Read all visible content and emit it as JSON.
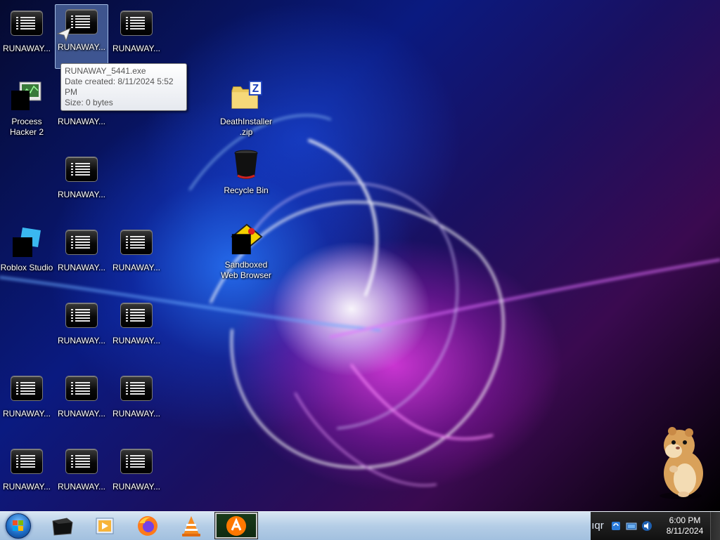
{
  "desktop_icons": [
    {
      "id": "r1",
      "label": "RUNAWAY...",
      "kind": "terminal"
    },
    {
      "id": "r2",
      "label": "RUNAWAY...",
      "kind": "terminal"
    },
    {
      "id": "r3",
      "label": "RUNAWAY...",
      "kind": "terminal"
    },
    {
      "id": "ph",
      "label": "Process Hacker 2",
      "kind": "process-hacker"
    },
    {
      "id": "r4",
      "label": "RUNAWAY...",
      "kind": "terminal"
    },
    {
      "id": "dz",
      "label": "DeathInstaller.zip",
      "kind": "zip"
    },
    {
      "id": "r5",
      "label": "RUNAWAY...",
      "kind": "terminal"
    },
    {
      "id": "rb",
      "label": "Recycle Bin",
      "kind": "recycle-bin"
    },
    {
      "id": "rs",
      "label": "Roblox Studio",
      "kind": "roblox-studio"
    },
    {
      "id": "r6",
      "label": "RUNAWAY...",
      "kind": "terminal"
    },
    {
      "id": "r7",
      "label": "RUNAWAY...",
      "kind": "terminal"
    },
    {
      "id": "sb",
      "label": "Sandboxed Web Browser",
      "kind": "sandboxed-browser"
    },
    {
      "id": "r8",
      "label": "RUNAWAY...",
      "kind": "terminal"
    },
    {
      "id": "r9",
      "label": "RUNAWAY...",
      "kind": "terminal"
    },
    {
      "id": "r10",
      "label": "RUNAWAY...",
      "kind": "terminal"
    },
    {
      "id": "r11",
      "label": "RUNAWAY...",
      "kind": "terminal"
    },
    {
      "id": "r12",
      "label": "RUNAWAY...",
      "kind": "terminal"
    },
    {
      "id": "r13",
      "label": "RUNAWAY...",
      "kind": "terminal"
    },
    {
      "id": "r14",
      "label": "RUNAWAY...",
      "kind": "terminal"
    },
    {
      "id": "r15",
      "label": "RUNAWAY...",
      "kind": "terminal"
    }
  ],
  "selected_icon": "r2",
  "tooltip": {
    "name": "RUNAWAY_5441.exe",
    "date_created": "Date created: 8/11/2024 5:52 PM",
    "size": "Size: 0 bytes"
  },
  "taskbar": {
    "items": [
      "terminal-icon",
      "media-player-icon",
      "firefox-icon",
      "vlc-icon",
      "avast-icon"
    ],
    "active_item": "avast-icon",
    "tray_overflow": "ıqr",
    "tray_icons": [
      "sync-icon",
      "network-icon",
      "volume-icon"
    ],
    "time": "6:00 PM",
    "date": "8/11/2024"
  },
  "colors": {
    "taskbar": "#b4cde6",
    "selection": "#82aae6",
    "tooltip_text": "#575757"
  }
}
